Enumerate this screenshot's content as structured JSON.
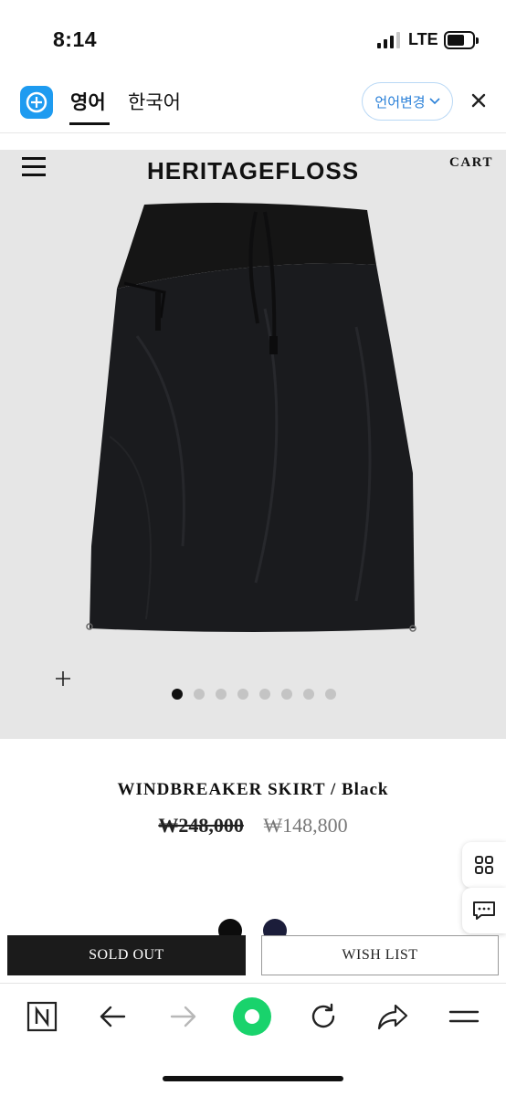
{
  "status_bar": {
    "time": "8:14",
    "network": "LTE",
    "battery_level": 0.6
  },
  "translate_bar": {
    "tabs": [
      {
        "label": "영어",
        "active": true
      },
      {
        "label": "한국어",
        "active": false
      }
    ],
    "change_language_label": "언어변경",
    "accent_color": "#2a80d8"
  },
  "site_header": {
    "brand": "HERITAGEFLOSS",
    "cart_label": "CART"
  },
  "gallery": {
    "slide_count": 8,
    "active_slide": 1
  },
  "product": {
    "name": "WINDBREAKER SKIRT / Black",
    "original_price": "₩248,000",
    "sale_price": "₩148,800",
    "color_swatches": [
      {
        "color": "#0c0c0c"
      },
      {
        "color": "#1b1d3a"
      }
    ]
  },
  "actions": {
    "sold_out_label": "SOLD OUT",
    "wish_list_label": "WISH LIST"
  },
  "side_buttons": [
    {
      "icon": "grid-icon"
    },
    {
      "icon": "chat-icon"
    }
  ],
  "browser_toolbar": {
    "icons": [
      "naver-icon",
      "back-arrow-icon",
      "forward-arrow-icon",
      "home-circle-icon",
      "refresh-icon",
      "share-icon",
      "menu-icon"
    ],
    "accent_color": "#19d36c"
  }
}
